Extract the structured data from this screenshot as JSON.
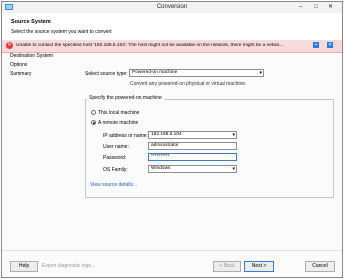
{
  "window": {
    "title": "Conversion",
    "controls": {
      "minimize": "–",
      "maximize": "□",
      "close": "✕"
    }
  },
  "header": {
    "title": "Source System",
    "subtitle": "Select the source system you want to convert"
  },
  "error_banner": {
    "text": "Unable to contact the specified host '192.168.6.104'. The host might not be available on the network, there might be a netwo...",
    "add_icon": "plus-icon",
    "close_icon": "close-icon"
  },
  "nav": {
    "items": [
      {
        "label": "Destination System"
      },
      {
        "label": "Options"
      },
      {
        "label": "Summary"
      }
    ]
  },
  "form": {
    "source_type_label": "Select source type:",
    "source_type_value": "Powered-on machine",
    "source_type_hint": "Convert any powered-on physical or virtual machine.",
    "group_title": "Specify the powered-on machine",
    "radio_local": "This local machine",
    "radio_remote": "A remote machine",
    "ip_label": "IP address or name:",
    "ip_value": "192.168.6.104",
    "user_label": "User name:",
    "user_value": "administrator",
    "password_label": "Password:",
    "password_value": "**********",
    "os_label": "OS Family:",
    "os_value": "Windows",
    "details_link": "View source details..."
  },
  "footer": {
    "help": "Help",
    "export_logs": "Export diagnostic logs...",
    "back": "< Back",
    "next": "Next >",
    "cancel": "Cancel"
  },
  "colors": {
    "error_bg": "#f9dada",
    "error_icon": "#e0393e",
    "link": "#1f5fbf",
    "focus": "#3a7bd5"
  }
}
